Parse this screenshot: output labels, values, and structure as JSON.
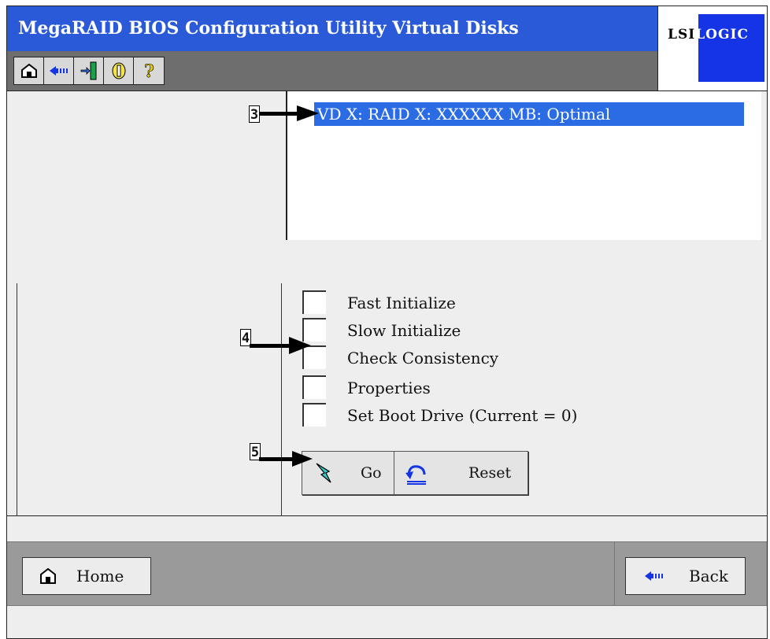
{
  "header": {
    "title": "MegaRAID BIOS Configuration Utility Virtual Disks",
    "toolbar": [
      {
        "icon": "home-icon"
      },
      {
        "icon": "back-arrow-icon"
      },
      {
        "icon": "exit-icon"
      },
      {
        "icon": "events-icon"
      },
      {
        "icon": "help-icon"
      }
    ]
  },
  "logo": {
    "text_dark": "LSI",
    "text_light": "LOGIC"
  },
  "virtual_disks": {
    "items": [
      "VD X: RAID X: XXXXXX MB: Optimal"
    ]
  },
  "options": [
    "Fast Initialize",
    "Slow Initialize",
    "Check Consistency",
    "Properties",
    "Set Boot Drive (Current = 0)"
  ],
  "actions": {
    "go_label": "Go",
    "reset_label": "Reset"
  },
  "markers": {
    "m3": "3",
    "m4": "4",
    "m5": "5"
  },
  "footer": {
    "home_label": "Home",
    "back_label": "Back"
  },
  "colors": {
    "title_blue": "#2b5ad8",
    "selection_blue": "#2b6ce4",
    "logo_blue": "#1434e6"
  }
}
